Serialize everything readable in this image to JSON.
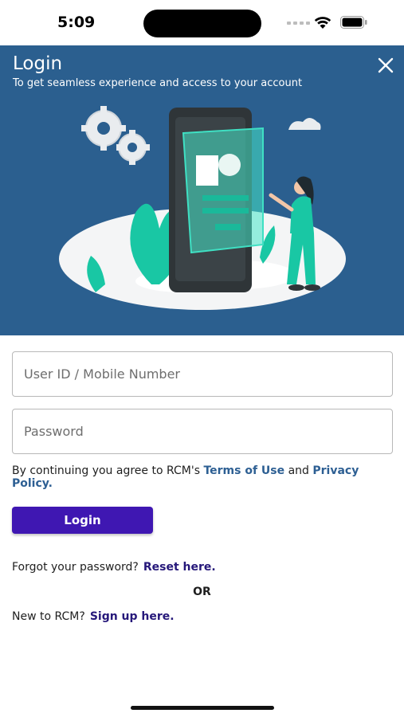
{
  "status_bar": {
    "time": "5:09"
  },
  "banner": {
    "title": "Login",
    "subtitle": "To get seamless experience and access to your account",
    "background_color": "#2b5f8f",
    "close_icon": "close-icon",
    "illustration": "login-illustration"
  },
  "form": {
    "user_id_placeholder": "User ID / Mobile Number",
    "user_id_value": "",
    "password_placeholder": "Password",
    "password_value": "",
    "terms_prefix": "By continuing you agree to RCM's ",
    "terms_link": "Terms of Use",
    "terms_and": " and ",
    "privacy_link": "Privacy Policy.",
    "login_label": "Login",
    "login_button_color": "#3f17b2"
  },
  "forgot": {
    "text": "Forgot your password?",
    "link": "Reset here."
  },
  "or_text": "OR",
  "signup": {
    "text": "New to RCM?",
    "link": "Sign up here."
  }
}
